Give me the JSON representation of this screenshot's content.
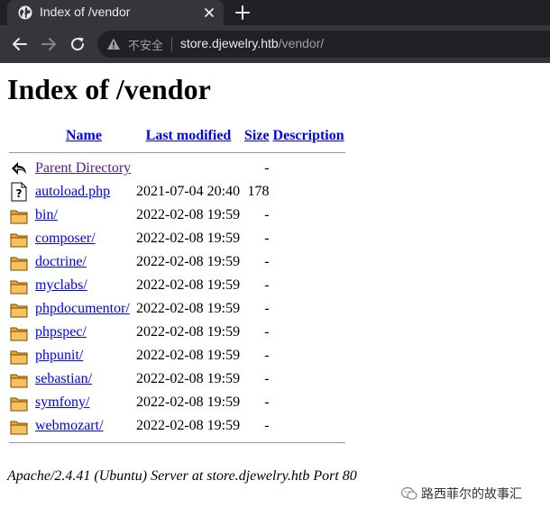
{
  "browser": {
    "tab_title": "Index of /vendor",
    "security_label": "不安全",
    "url_host": "store.djewelry.htb",
    "url_path": "/vendor/"
  },
  "page": {
    "heading": "Index of /vendor",
    "columns": {
      "name": "Name",
      "last_modified": "Last modified",
      "size": "Size",
      "description": "Description"
    },
    "parent": {
      "label": "Parent Directory",
      "size": "-",
      "icon": "back-arrow-icon"
    },
    "entries": [
      {
        "name": "autoload.php",
        "modified": "2021-07-04 20:40",
        "size": "178",
        "icon": "file-icon"
      },
      {
        "name": "bin/",
        "modified": "2022-02-08 19:59",
        "size": "-",
        "icon": "folder-icon"
      },
      {
        "name": "composer/",
        "modified": "2022-02-08 19:59",
        "size": "-",
        "icon": "folder-icon"
      },
      {
        "name": "doctrine/",
        "modified": "2022-02-08 19:59",
        "size": "-",
        "icon": "folder-icon"
      },
      {
        "name": "myclabs/",
        "modified": "2022-02-08 19:59",
        "size": "-",
        "icon": "folder-icon"
      },
      {
        "name": "phpdocumentor/",
        "modified": "2022-02-08 19:59",
        "size": "-",
        "icon": "folder-icon"
      },
      {
        "name": "phpspec/",
        "modified": "2022-02-08 19:59",
        "size": "-",
        "icon": "folder-icon"
      },
      {
        "name": "phpunit/",
        "modified": "2022-02-08 19:59",
        "size": "-",
        "icon": "folder-icon"
      },
      {
        "name": "sebastian/",
        "modified": "2022-02-08 19:59",
        "size": "-",
        "icon": "folder-icon"
      },
      {
        "name": "symfony/",
        "modified": "2022-02-08 19:59",
        "size": "-",
        "icon": "folder-icon"
      },
      {
        "name": "webmozart/",
        "modified": "2022-02-08 19:59",
        "size": "-",
        "icon": "folder-icon"
      }
    ],
    "footer": "Apache/2.4.41 (Ubuntu) Server at store.djewelry.htb Port 80"
  },
  "watermark": "路西菲尔的故事汇",
  "colors": {
    "link": "#0000ee",
    "visited": "#551a8b",
    "chrome_dark": "#202124",
    "chrome_tab": "#35363a"
  }
}
